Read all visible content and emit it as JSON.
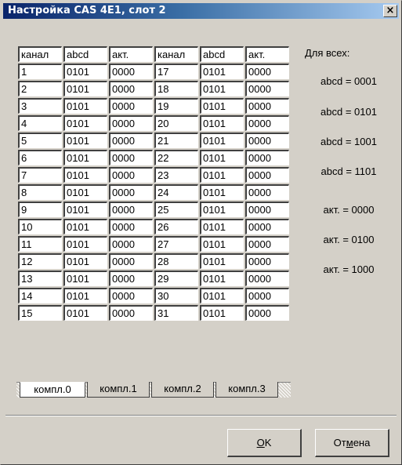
{
  "window": {
    "title": "Настройка CAS 4E1, слот 2",
    "close_glyph": "×"
  },
  "table": {
    "headers": [
      "канал",
      "abcd",
      "акт.",
      "канал",
      "abcd",
      "акт."
    ],
    "rows": [
      [
        "1",
        "0101",
        "0000",
        "17",
        "0101",
        "0000"
      ],
      [
        "2",
        "0101",
        "0000",
        "18",
        "0101",
        "0000"
      ],
      [
        "3",
        "0101",
        "0000",
        "19",
        "0101",
        "0000"
      ],
      [
        "4",
        "0101",
        "0000",
        "20",
        "0101",
        "0000"
      ],
      [
        "5",
        "0101",
        "0000",
        "21",
        "0101",
        "0000"
      ],
      [
        "6",
        "0101",
        "0000",
        "22",
        "0101",
        "0000"
      ],
      [
        "7",
        "0101",
        "0000",
        "23",
        "0101",
        "0000"
      ],
      [
        "8",
        "0101",
        "0000",
        "24",
        "0101",
        "0000"
      ],
      [
        "9",
        "0101",
        "0000",
        "25",
        "0101",
        "0000"
      ],
      [
        "10",
        "0101",
        "0000",
        "26",
        "0101",
        "0000"
      ],
      [
        "11",
        "0101",
        "0000",
        "27",
        "0101",
        "0000"
      ],
      [
        "12",
        "0101",
        "0000",
        "28",
        "0101",
        "0000"
      ],
      [
        "13",
        "0101",
        "0000",
        "29",
        "0101",
        "0000"
      ],
      [
        "14",
        "0101",
        "0000",
        "30",
        "0101",
        "0000"
      ],
      [
        "15",
        "0101",
        "0000",
        "31",
        "0101",
        "0000"
      ]
    ]
  },
  "tabs": [
    {
      "label": "компл.0",
      "active": true
    },
    {
      "label": "компл.1",
      "active": false
    },
    {
      "label": "компл.2",
      "active": false
    },
    {
      "label": "компл.3",
      "active": false
    }
  ],
  "sidebar": {
    "title": "Для всех:",
    "abcd_buttons": [
      "abcd = 0001",
      "abcd = 0101",
      "abcd = 1001",
      "abcd = 1101"
    ],
    "akt_buttons": [
      "акт. = 0000",
      "акт. = 0100",
      "акт. = 1000"
    ]
  },
  "buttons": {
    "ok_mnemonic": "O",
    "ok_rest": "K",
    "cancel_prefix": "От",
    "cancel_mnemonic": "м",
    "cancel_rest": "ена"
  }
}
